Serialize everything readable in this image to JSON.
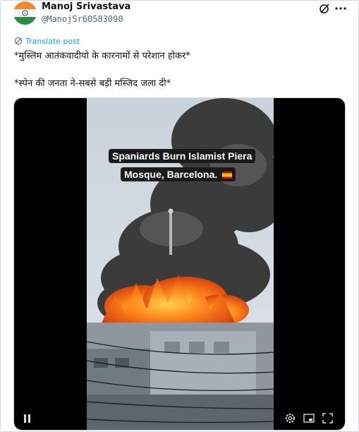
{
  "tweet": {
    "author": {
      "display_name": "Manoj Srivastava",
      "handle": "@ManojSr60583090",
      "avatar": "india-flag-avatar"
    },
    "translate_label": "Translate post",
    "text_lines": [
      "*मुस्लिम आतंकवादीयो के कारनामों से परेशान होकर*",
      "*स्पेन की जनता ने-सबसे बड़ी मस्जिद जला दी*"
    ],
    "video": {
      "overlay_line1": "Spaniards Burn Islamist Piera",
      "overlay_line2": "Mosque, Barcelona.",
      "overlay_icon": "spain-flag-icon"
    }
  },
  "icons": {
    "grok": "grok-icon",
    "more": "more-icon",
    "translate": "globe-icon",
    "pause": "pause-icon",
    "settings": "settings-icon",
    "pip": "picture-in-picture-icon",
    "fullscreen": "fullscreen-icon"
  },
  "colors": {
    "text_primary": "#0f1419",
    "text_secondary": "#536471",
    "link": "#1d9bf0",
    "border": "#cfd9de",
    "media_bg": "#000000"
  }
}
